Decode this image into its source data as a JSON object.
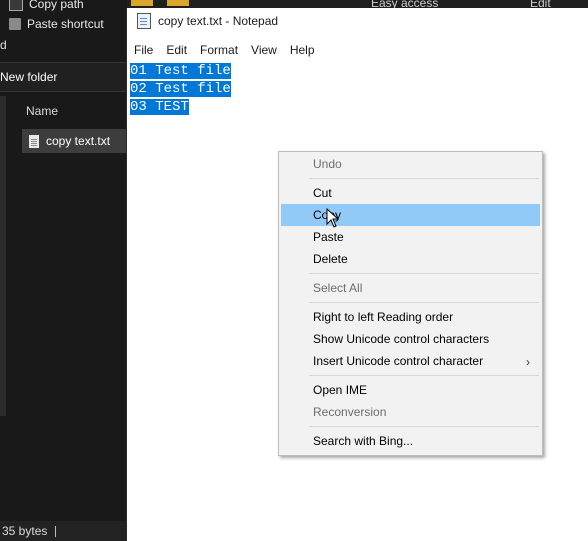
{
  "explorer": {
    "ribbon": {
      "copy_path": "Copy path",
      "paste_shortcut": "Paste shortcut"
    },
    "top_strip": {
      "easy_access": "Easy access",
      "edit": "Edit"
    },
    "address_fragment": "d",
    "current_folder": "New folder",
    "column_name": "Name",
    "file_name": "copy text.txt",
    "status_size": "35 bytes"
  },
  "notepad": {
    "title": "copy text.txt - Notepad",
    "menu": [
      "File",
      "Edit",
      "Format",
      "View",
      "Help"
    ],
    "lines": [
      "01 Test file",
      "02 Test file",
      "03 TEST"
    ],
    "selection_color": "#0078d7"
  },
  "context_menu": {
    "items": [
      {
        "label": "Undo",
        "disabled": true
      },
      {
        "label": "Cut",
        "disabled": false
      },
      {
        "label": "Copy",
        "disabled": false,
        "highlighted": true
      },
      {
        "label": "Paste",
        "disabled": false
      },
      {
        "label": "Delete",
        "disabled": false
      },
      {
        "label": "Select All",
        "disabled": true
      },
      {
        "label": "Right to left Reading order",
        "disabled": false
      },
      {
        "label": "Show Unicode control characters",
        "disabled": false
      },
      {
        "label": "Insert Unicode control character",
        "disabled": false,
        "submenu": true
      },
      {
        "label": "Open IME",
        "disabled": false
      },
      {
        "label": "Reconversion",
        "disabled": true
      },
      {
        "label": "Search with Bing...",
        "disabled": false
      }
    ],
    "submenu_arrow": "›",
    "highlight_color": "#91c9f7"
  }
}
